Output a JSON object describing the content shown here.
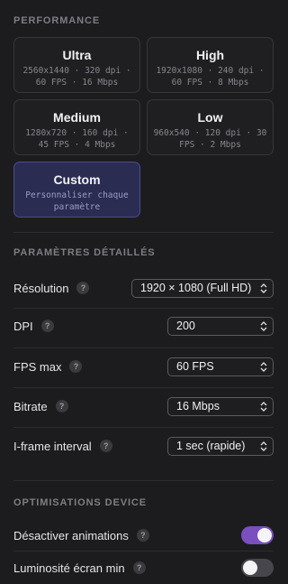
{
  "performance": {
    "title": "PERFORMANCE",
    "presets": [
      {
        "name": "Ultra",
        "desc": "2560x1440 · 320 dpi · 60 FPS · 16 Mbps",
        "active": false
      },
      {
        "name": "High",
        "desc": "1920x1080 · 240 dpi · 60 FPS · 8 Mbps",
        "active": false
      },
      {
        "name": "Medium",
        "desc": "1280x720 · 160 dpi · 45 FPS · 4 Mbps",
        "active": false
      },
      {
        "name": "Low",
        "desc": "960x540 · 120 dpi · 30 FPS · 2 Mbps",
        "active": false
      },
      {
        "name": "Custom",
        "desc": "Personnaliser chaque paramètre",
        "active": true
      }
    ]
  },
  "details": {
    "title": "PARAMÈTRES DÉTAILLÉS",
    "rows": [
      {
        "label": "Résolution",
        "value": "1920 × 1080 (Full HD)"
      },
      {
        "label": "DPI",
        "value": "200"
      },
      {
        "label": "FPS max",
        "value": "60 FPS"
      },
      {
        "label": "Bitrate",
        "value": "16 Mbps"
      },
      {
        "label": "I-frame interval",
        "value": "1 sec (rapide)"
      }
    ],
    "help_glyph": "?"
  },
  "device": {
    "title": "OPTIMISATIONS DEVICE",
    "toggles": [
      {
        "label": "Désactiver animations",
        "on": true
      },
      {
        "label": "Luminosité écran min",
        "on": false
      }
    ]
  },
  "colors": {
    "background": "#1c1c1e",
    "accent_toggle": "#7a4fc0",
    "active_preset": "#2b2c52"
  }
}
